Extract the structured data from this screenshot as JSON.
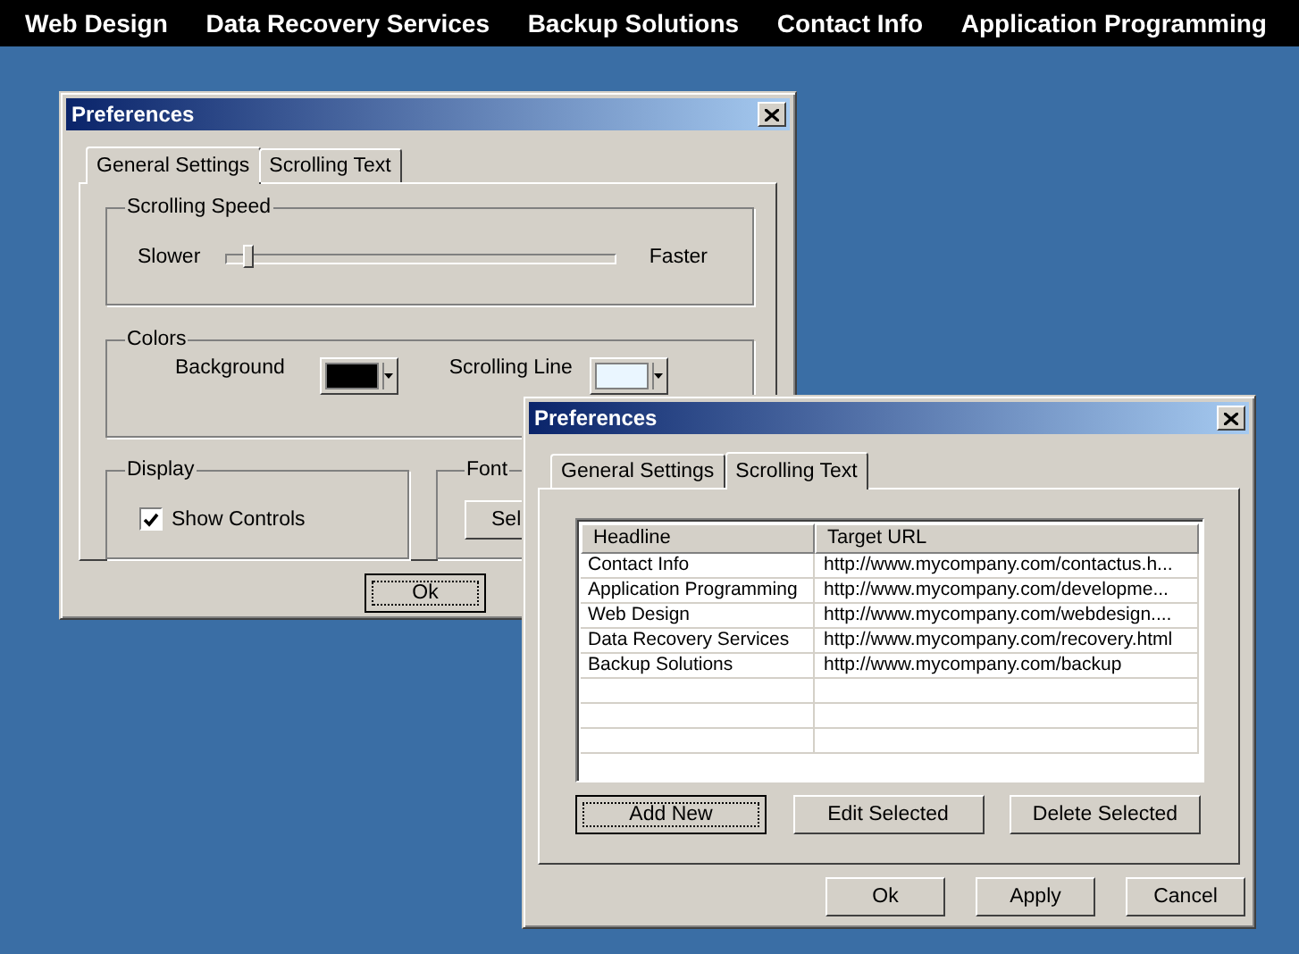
{
  "menu": [
    {
      "label": "Web Design"
    },
    {
      "label": "Data Recovery Services"
    },
    {
      "label": "Backup Solutions"
    },
    {
      "label": "Contact Info"
    },
    {
      "label": "Application Programming"
    }
  ],
  "back_window": {
    "title": "Preferences",
    "tabs": [
      {
        "label": "General Settings",
        "selected": true
      },
      {
        "label": "Scrolling Text",
        "selected": false
      }
    ],
    "scrolling_speed": {
      "label": "Scrolling Speed",
      "min_label": "Slower",
      "max_label": "Faster",
      "level": 0.06
    },
    "colors": {
      "label": "Colors",
      "items": [
        {
          "label": "Background",
          "color": "#000000"
        },
        {
          "label": "Scrolling Line",
          "color": "#eaf6ff"
        }
      ]
    },
    "display": {
      "label": "Display",
      "show_controls": {
        "label": "Show Controls",
        "checked": true
      }
    },
    "font": {
      "label": "Font",
      "button": "Sel"
    },
    "buttons": [
      {
        "label": "Ok",
        "focused": true
      }
    ]
  },
  "front_window": {
    "title": "Preferences",
    "tabs": [
      {
        "label": "General Settings",
        "selected": false
      },
      {
        "label": "Scrolling Text",
        "selected": true
      }
    ],
    "table": {
      "columns": [
        "Headline",
        "Target URL"
      ],
      "rows": [
        [
          "Contact Info",
          "http://www.mycompany.com/contactus.h..."
        ],
        [
          "Application Programming",
          "http://www.mycompany.com/developme..."
        ],
        [
          "Web Design",
          "http://www.mycompany.com/webdesign...."
        ],
        [
          "Data Recovery Services",
          "http://www.mycompany.com/recovery.html"
        ],
        [
          "Backup Solutions",
          "http://www.mycompany.com/backup"
        ]
      ]
    },
    "actions": [
      {
        "label": "Add New",
        "focused": true
      },
      {
        "label": "Edit Selected",
        "focused": false
      },
      {
        "label": "Delete Selected",
        "focused": false
      }
    ],
    "buttons": [
      {
        "label": "Ok",
        "focused": false
      },
      {
        "label": "Apply",
        "focused": false
      },
      {
        "label": "Cancel",
        "focused": false
      }
    ]
  }
}
